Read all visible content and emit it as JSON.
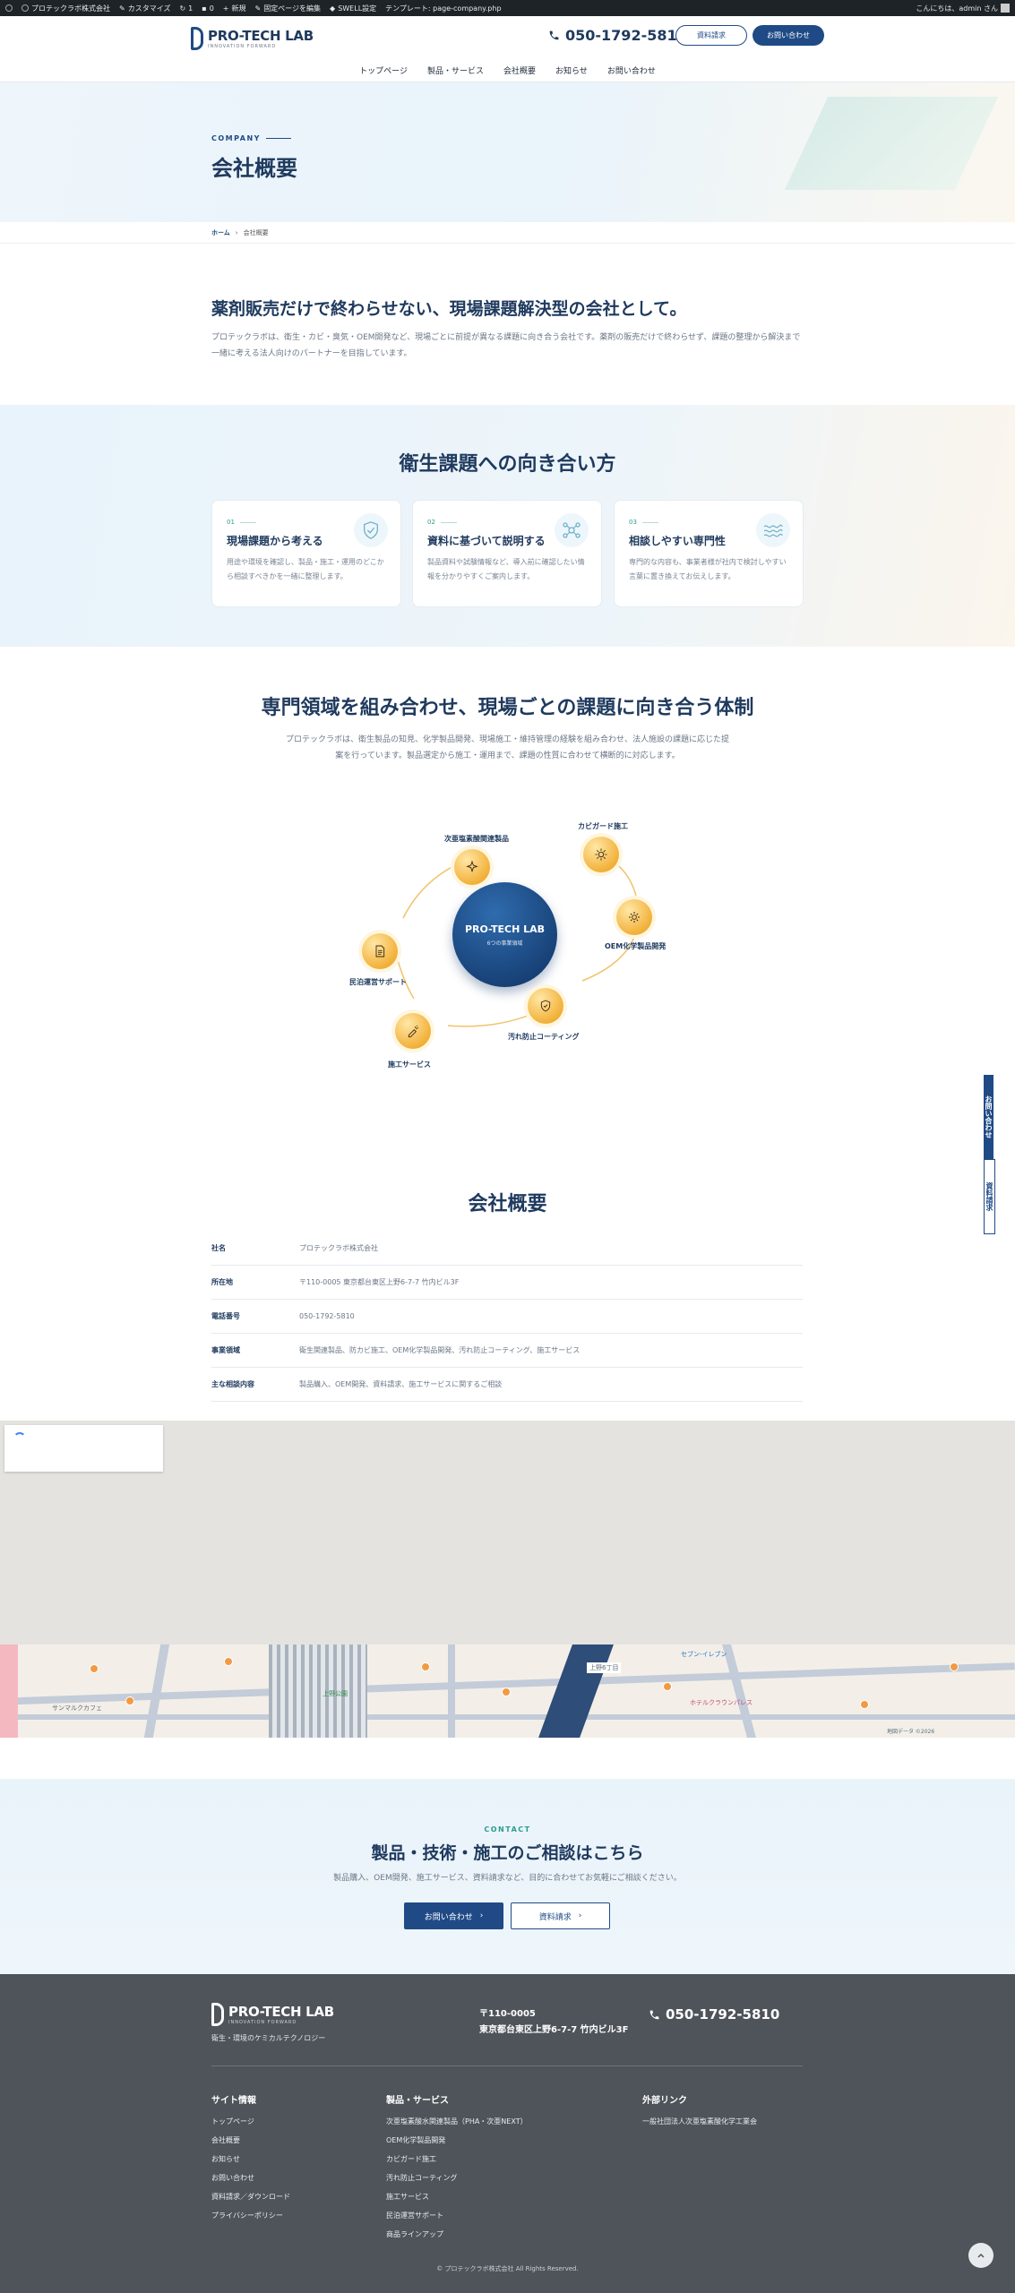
{
  "adminbar": {
    "site_name": "プロテックラボ株式会社",
    "customize": "カスタマイズ",
    "updates": "1",
    "comments": "0",
    "new": "新規",
    "edit_page": "固定ページを編集",
    "swell": "SWELL設定",
    "template": "テンプレート: page-company.php",
    "greeting": "こんにちは、admin さん"
  },
  "header": {
    "logo_name": "PRO-TECH LAB",
    "logo_sub": "INNOVATION FORWARD",
    "phone": "050-1792-5810",
    "btn_document": "資料請求",
    "btn_contact": "お問い合わせ",
    "nav": [
      {
        "label": "トップページ"
      },
      {
        "label": "製品・サービス"
      },
      {
        "label": "会社概要"
      },
      {
        "label": "お知らせ"
      },
      {
        "label": "お問い合わせ"
      }
    ]
  },
  "hero": {
    "label": "COMPANY",
    "title": "会社概要"
  },
  "breadcrumb": {
    "home": "ホーム",
    "sep": "›",
    "current": "会社概要"
  },
  "intro": {
    "title": "薬剤販売だけで終わらせない、現場課題解決型の会社として。",
    "text": "プロテックラボは、衛生・カビ・臭気・OEM開発など、現場ごとに前提が異なる課題に向き合う会社です。薬剤の販売だけで終わらせず、課題の整理から解決まで一緒に考える法人向けのパートナーを目指しています。"
  },
  "approach": {
    "title": "衛生課題への向き合い方",
    "cards": [
      {
        "num": "01",
        "title": "現場課題から考える",
        "desc": "用途や環境を確認し、製品・施工・運用のどこから相談すべきかを一緒に整理します。",
        "icon": "shield-check-icon"
      },
      {
        "num": "02",
        "title": "資料に基づいて説明する",
        "desc": "製品資料や試験情報など、導入前に確認したい情報を分かりやすくご案内します。",
        "icon": "molecule-icon"
      },
      {
        "num": "03",
        "title": "相談しやすい専門性",
        "desc": "専門的な内容も、事業者様が社内で検討しやすい言葉に置き換えてお伝えします。",
        "icon": "waves-icon"
      }
    ]
  },
  "system": {
    "title": "専門領域を組み合わせ、現場ごとの課題に向き合う体制",
    "text": "プロテックラボは、衛生製品の知見、化学製品開発、現場施工・維持管理の経験を組み合わせ、法人施設の課題に応じた提案を行っています。製品選定から施工・運用まで、課題の性質に合わせて横断的に対応します。",
    "core_title": "PRO-TECH LAB",
    "core_sub": "6つの事業領域",
    "nodes": [
      {
        "label": "次亜塩素酸関連製品",
        "icon": "sparkle-icon"
      },
      {
        "label": "カビガード施工",
        "icon": "sun-gear-icon"
      },
      {
        "label": "OEM化学製品開発",
        "icon": "gear-icon"
      },
      {
        "label": "汚れ防止コーティング",
        "icon": "shield-icon"
      },
      {
        "label": "施工サービス",
        "icon": "spray-icon"
      },
      {
        "label": "民泊運営サポート",
        "icon": "document-icon"
      }
    ]
  },
  "company": {
    "title": "会社概要",
    "rows": [
      {
        "key": "社名",
        "value": "プロテックラボ株式会社"
      },
      {
        "key": "所在地",
        "value": "〒110-0005 東京都台東区上野6-7-7 竹内ビル3F"
      },
      {
        "key": "電話番号",
        "value": "050-1792-5810"
      },
      {
        "key": "事業領域",
        "value": "衛生関連製品、防カビ施工、OEM化学製品開発、汚れ防止コーティング、施工サービス"
      },
      {
        "key": "主な相談内容",
        "value": "製品購入、OEM開発、資料請求、施工サービスに関するご相談"
      }
    ]
  },
  "map": {
    "labels": [
      {
        "text": "上野6丁目"
      },
      {
        "text": "セブン-イレブン"
      },
      {
        "text": "ホテルクラウンパレス"
      },
      {
        "text": "サンマルクカフェ"
      },
      {
        "text": "上野公園"
      },
      {
        "text": "地図データ ©2026"
      }
    ]
  },
  "contact": {
    "label": "CONTACT",
    "title": "製品・技術・施工のご相談はこちら",
    "text": "製品購入、OEM開発、施工サービス、資料請求など、目的に合わせてお気軽にご相談ください。",
    "btn_contact": "お問い合わせ",
    "btn_document": "資料請求",
    "arrow": "›"
  },
  "footer": {
    "logo_name": "PRO-TECH LAB",
    "logo_sub": "INNOVATION FORWARD",
    "tagline": "衛生・環境のケミカルテクノロジー",
    "zip": "〒110-0005",
    "address": "東京都台東区上野6-7-7 竹内ビル3F",
    "phone": "050-1792-5810",
    "col1_title": "サイト情報",
    "col1": [
      {
        "label": "トップページ"
      },
      {
        "label": "会社概要"
      },
      {
        "label": "お知らせ"
      },
      {
        "label": "お問い合わせ"
      },
      {
        "label": "資料請求／ダウンロード"
      },
      {
        "label": "プライバシーポリシー"
      }
    ],
    "col2_title": "製品・サービス",
    "col2": [
      {
        "label": "次亜塩素酸水関連製品（PHA・次亜NEXT）"
      },
      {
        "label": "OEM化学製品開発"
      },
      {
        "label": "カビガード施工"
      },
      {
        "label": "汚れ防止コーティング"
      },
      {
        "label": "施工サービス"
      },
      {
        "label": "民泊運営サポート"
      },
      {
        "label": "商品ラインアップ"
      }
    ],
    "col3_title": "外部リンク",
    "col3": [
      {
        "label": "一般社団法人次亜塩素酸化学工業会"
      }
    ],
    "copyright": "© プロテックラボ株式会社 All Rights Reserved."
  },
  "side": {
    "contact": "お問い合わせ",
    "document": "資料請求"
  },
  "colors": {
    "primary": "#1f4a86",
    "accent": "#2a9d8f",
    "node": "#f2b13a",
    "footer_bg": "#4e545a"
  }
}
